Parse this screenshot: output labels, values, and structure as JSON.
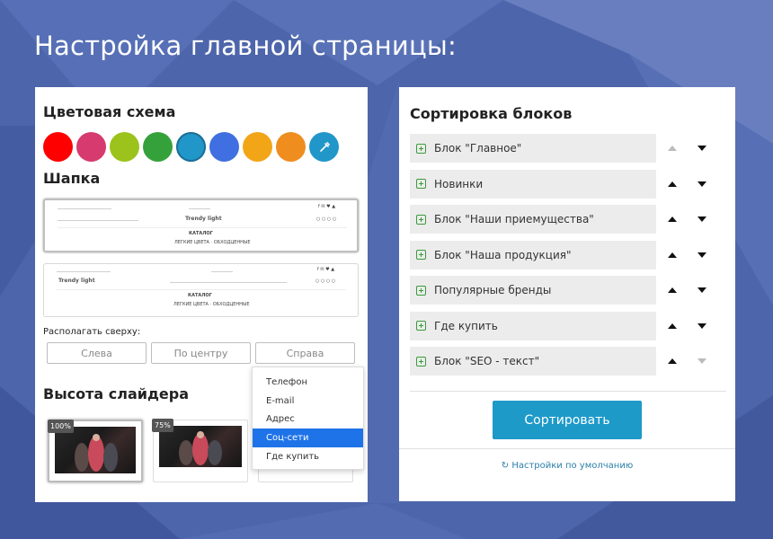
{
  "page": {
    "title": "Настройка главной страницы:",
    "background_color": "#4a62a8"
  },
  "left_panel": {
    "color_scheme_title": "Цветовая схема",
    "color_swatches": [
      {
        "color": "#ff0000",
        "selected": false
      },
      {
        "color": "#d63a6e",
        "selected": false
      },
      {
        "color": "#9bc31c",
        "selected": false
      },
      {
        "color": "#35a13a",
        "selected": false
      },
      {
        "color": "#2196c9",
        "selected": true
      },
      {
        "color": "#3f6fe0",
        "selected": false
      },
      {
        "color": "#f2a516",
        "selected": false
      },
      {
        "color": "#ef8d1f",
        "selected": false
      },
      {
        "color": "#2196c9",
        "selected": false,
        "icon": "eyedropper-icon"
      }
    ],
    "header_title": "Шапка",
    "header_previews": [
      {
        "brand": "Trendy light",
        "nav_label": "КАТАЛОГ",
        "sub_links": "ЛЕГКИЕ ЦВЕТА · ОБХОДЦЕННЫЕ",
        "active": true
      },
      {
        "brand": "Trendy light",
        "nav_label": "КАТАЛОГ",
        "sub_links": "ЛЕГКИЕ ЦВЕТА · ОБХОДЦЕННЫЕ",
        "active": false
      }
    ],
    "place_top_label": "Располагать сверху:",
    "position_buttons": [
      "Слева",
      "По центру",
      "Справа"
    ],
    "dropdown_items": [
      {
        "label": "Телефон",
        "selected": false
      },
      {
        "label": "E-mail",
        "selected": false
      },
      {
        "label": "Адрес",
        "selected": false
      },
      {
        "label": "Соц-сети",
        "selected": true
      },
      {
        "label": "Где купить",
        "selected": false
      }
    ],
    "slider_height_title": "Высота слайдера",
    "slider_options": [
      {
        "percent": "100%",
        "active": true
      },
      {
        "percent": "75%",
        "active": false
      },
      {
        "percent": "",
        "active": false
      }
    ]
  },
  "right_panel": {
    "title": "Сортировка блоков",
    "blocks": [
      {
        "label": "Блок \"Главное\"",
        "up_enabled": false,
        "down_enabled": true
      },
      {
        "label": "Новинки",
        "up_enabled": true,
        "down_enabled": true
      },
      {
        "label": "Блок \"Наши приемущества\"",
        "up_enabled": true,
        "down_enabled": true
      },
      {
        "label": "Блок \"Наша продукция\"",
        "up_enabled": true,
        "down_enabled": true
      },
      {
        "label": "Популярные бренды",
        "up_enabled": true,
        "down_enabled": true
      },
      {
        "label": "Где купить",
        "up_enabled": true,
        "down_enabled": true
      },
      {
        "label": "Блок \"SEO - текст\"",
        "up_enabled": true,
        "down_enabled": false
      }
    ],
    "sort_button": "Сортировать",
    "default_link": "Настройки по умолчанию"
  }
}
